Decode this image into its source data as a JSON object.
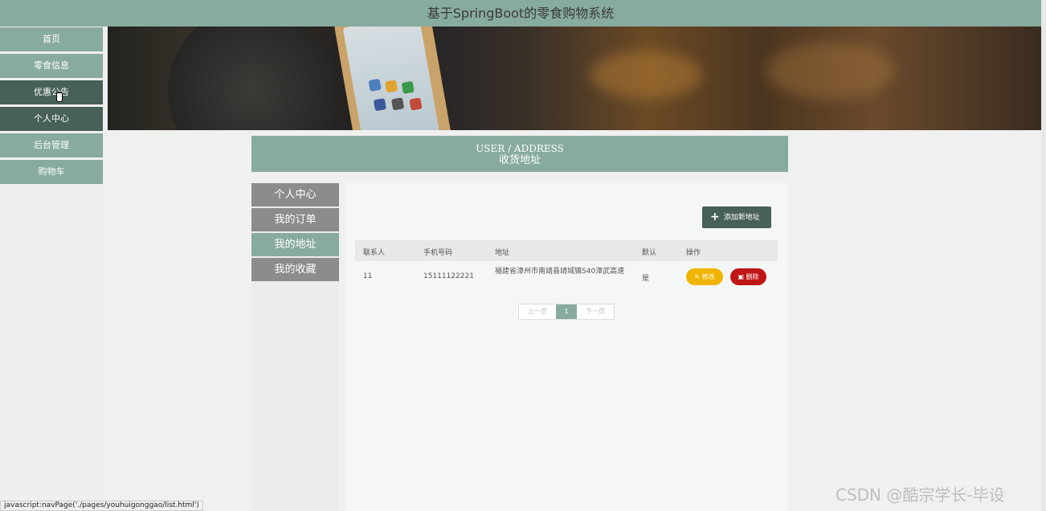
{
  "header": {
    "title": "基于SpringBoot的零食购物系统"
  },
  "nav": {
    "items": [
      {
        "label": "首页"
      },
      {
        "label": "零食信息"
      },
      {
        "label": "优惠公告"
      },
      {
        "label": "个人中心"
      },
      {
        "label": "后台管理"
      },
      {
        "label": "购物车"
      }
    ]
  },
  "page": {
    "title_en": "USER / ADDRESS",
    "title_cn": "收货地址"
  },
  "subnav": {
    "items": [
      {
        "label": "个人中心"
      },
      {
        "label": "我的订单"
      },
      {
        "label": "我的地址"
      },
      {
        "label": "我的收藏"
      }
    ]
  },
  "toolbar": {
    "add_label": "添加新地址"
  },
  "table": {
    "headers": [
      "联系人",
      "手机号码",
      "地址",
      "默认",
      "操作"
    ],
    "rows": [
      {
        "contact": "11",
        "phone": "15111122221",
        "address": "福建省漳州市南靖县靖城镇S40漳武高速",
        "default": "是"
      }
    ],
    "edit_label": "修改",
    "delete_label": "删除"
  },
  "pagination": {
    "prev": "上一页",
    "current": "1",
    "next": "下一页"
  },
  "status_bar": {
    "text": "javascript:navPage('./pages/youhuigonggao/list.html')"
  },
  "watermark": "CSDN @酷宗学长-毕设",
  "colors": {
    "accent": "#88ab9f",
    "dark": "#47605a",
    "edit": "#f0b400",
    "delete": "#c01616"
  }
}
